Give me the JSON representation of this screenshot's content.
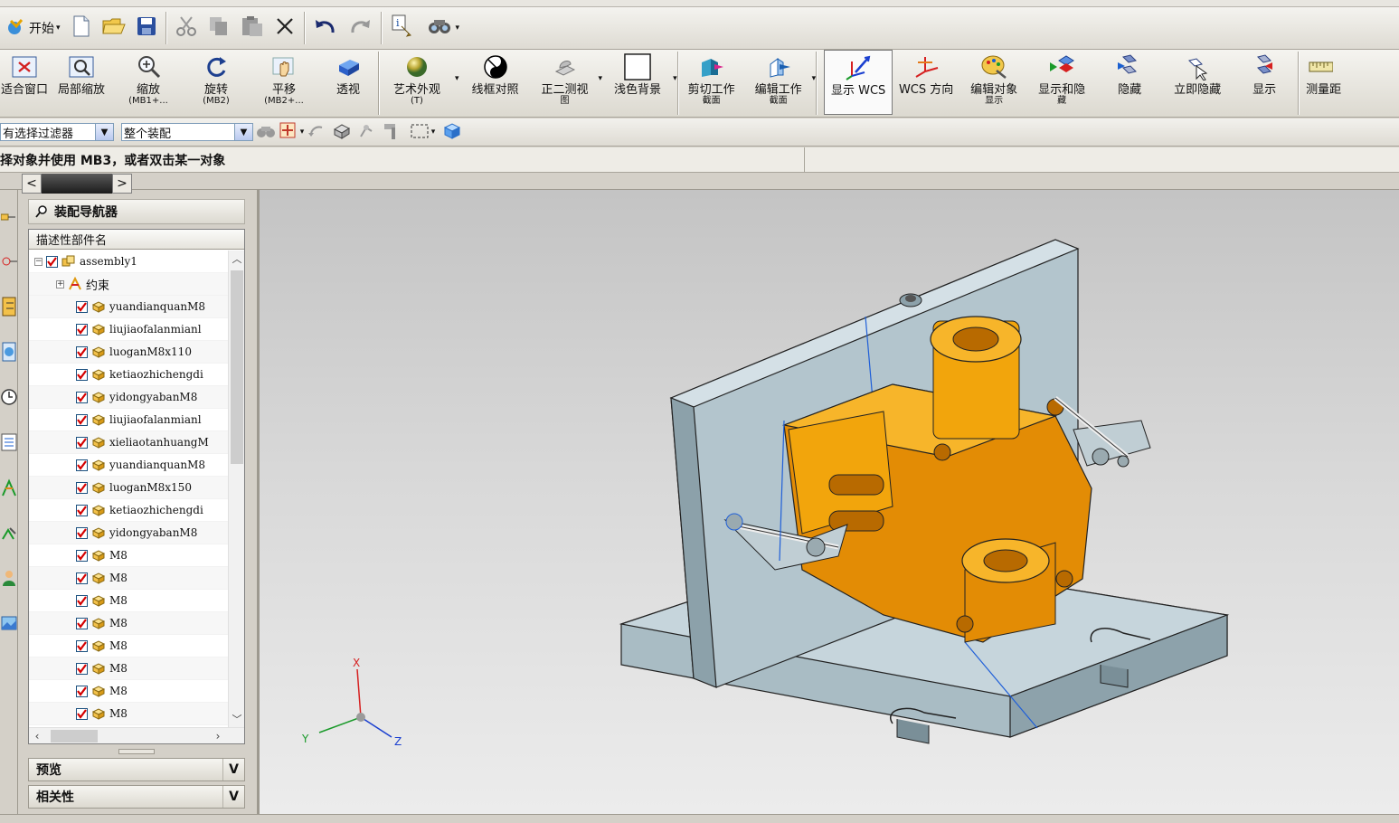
{
  "std_toolbar": {
    "start_label": "开始"
  },
  "view_toolbar": {
    "buttons": [
      {
        "label": "适合窗口",
        "sub": ""
      },
      {
        "label": "局部缩放",
        "sub": ""
      },
      {
        "label": "缩放",
        "sub": "(MB1+..."
      },
      {
        "label": "旋转",
        "sub": "(MB2)"
      },
      {
        "label": "平移",
        "sub": "(MB2+..."
      },
      {
        "label": "透视",
        "sub": ""
      },
      {
        "label": "艺术外观",
        "sub": "(T)"
      },
      {
        "label": "线框对照",
        "sub": ""
      },
      {
        "label": "正二测视",
        "sub": "图"
      },
      {
        "label": "浅色背景",
        "sub": ""
      },
      {
        "label": "剪切工作",
        "sub": "截面"
      },
      {
        "label": "编辑工作",
        "sub": "截面"
      },
      {
        "label": "显示 WCS",
        "sub": ""
      },
      {
        "label": "WCS 方向",
        "sub": ""
      },
      {
        "label": "编辑对象",
        "sub": "显示"
      },
      {
        "label": "显示和隐",
        "sub": "藏"
      },
      {
        "label": "隐藏",
        "sub": ""
      },
      {
        "label": "立即隐藏",
        "sub": ""
      },
      {
        "label": "显示",
        "sub": ""
      },
      {
        "label": "测量距",
        "sub": ""
      }
    ]
  },
  "selection_toolbar": {
    "filter_value": "有选择过滤器",
    "scope_value": "整个装配"
  },
  "status": {
    "prompt": "择对象并使用 MB3，或者双击某一对象"
  },
  "navigator": {
    "title": "装配导航器",
    "column_header": "描述性部件名",
    "root": "assembly1",
    "constraints": "约束",
    "parts": [
      "yuandianquanM8",
      "liujiaofalanmianl",
      "luoganM8x110",
      "ketiaozhichengdi",
      "yidongyabanM8",
      "liujiaofalanmianl",
      "xieliaotanhuangM",
      "yuandianquanM8",
      "luoganM8x150",
      "ketiaozhichengdi",
      "yidongyabanM8",
      "M8",
      "M8",
      "M8",
      "M8",
      "M8",
      "M8",
      "M8",
      "M8"
    ],
    "preview_label": "预览",
    "dependency_label": "相关性"
  },
  "triad": {
    "x": "X",
    "y": "Y",
    "z": "Z"
  },
  "colors": {
    "part_orange": "#f2a50c",
    "plate_gray": "#a9bcc4",
    "wcs_blue": "#1f5fd8",
    "check_red": "#d40000"
  }
}
